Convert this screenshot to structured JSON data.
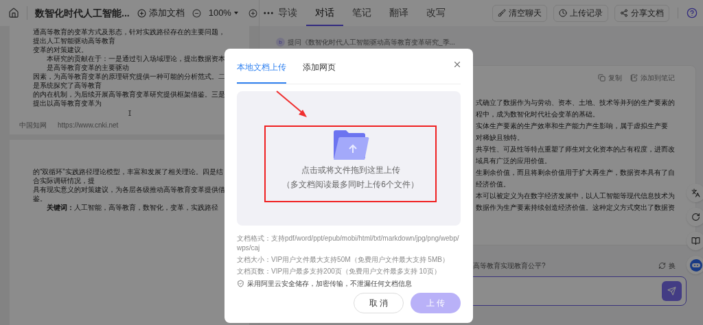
{
  "toolbar": {
    "title": "数智化时代人工智能...",
    "add_document": "添加文档",
    "zoom": "100%"
  },
  "tabs": [
    {
      "label": "导读",
      "selected": false
    },
    {
      "label": "对话",
      "selected": true
    },
    {
      "label": "笔记",
      "selected": false
    },
    {
      "label": "翻译",
      "selected": false
    },
    {
      "label": "改写",
      "selected": false
    }
  ],
  "actions": [
    "清空聊天",
    "上传记录",
    "分享文档"
  ],
  "document": {
    "pages": [
      {
        "lines": [
          {
            "text": "通高等教育的变革方式及形态，针对实践路径存在的主要问题，提出人工智能驱动高等教育",
            "indent": false
          },
          {
            "text": "变革的对策建议。",
            "indent": false
          },
          {
            "text": "本研究的贡献在于：一是通过引入场域理论，提出数据资本是高等教育变革的主要驱动",
            "indent": true
          },
          {
            "text": "因素，为高等教育变革的原理研究提供一种可能的分析范式。二是系统探究了高等教育",
            "indent": false
          },
          {
            "text": "的内在机制，为后续开展高等教育变革研究提供框架借鉴。三是提出以高等教育变革为",
            "indent": false
          }
        ],
        "footer": [
          "中国知网",
          "https://www.cnki.net"
        ]
      },
      {
        "lines": [
          {
            "text": "的“双循环”实践路径理论模型，丰富和发展了相关理论。四是结合实际调研情况，提",
            "indent": false
          },
          {
            "text": "具有现实意义的对策建议，为各层各级推动高等教育变革提供借鉴。",
            "indent": false
          },
          {
            "text": "**关键词：**人工智能，高等教育，数智化，变革，实践路径",
            "indent": true
          }
        ]
      }
    ]
  },
  "chat": {
    "question": "提问《数智化时代人工智能驱动高等教育变革研究_季...",
    "avatar": "b",
    "answer_actions": [
      "复制",
      "添加到笔记"
    ],
    "answer_lines": [
      "式确立了数据作为与劳动、资本、土地、技术等并列的生产要素的",
      "程中，成为数智化时代社会变革的基础。",
      "实体生产要素的生产效率和生产能力产生影响，属于虚拟生产要",
      "对稀缺且独特。",
      "共享性、可及性等特点重塑了师生对文化资本的占有程度，进而改",
      "域具有广泛的应用价值。",
      "生剩余价值，而且将剩余价值用于扩大再生产，数据资本具有了自",
      "经济价值。",
      "本可以被定义为在数字经济发展中，以人工智能等现代信息技术为",
      "数据作为生产要素持续创造经济价值。这种定义方式突出了数据资"
    ],
    "suggestion": "高等教育实现教育公平?",
    "refresh": "换"
  },
  "dialog": {
    "tabs": [
      {
        "label": "本地文档上传",
        "selected": true
      },
      {
        "label": "添加网页",
        "selected": false
      }
    ],
    "drop_text": "点击或将文件拖到这里上传",
    "drop_hint": "（多文档阅读最多同时上传6个文件）",
    "info": [
      "文档格式：支持pdf/word/ppt/epub/mobi/html/txt/markdown/jpg/png/webp/wps/caj",
      "文档大小：VIP用户文件最大支持50M（免费用户文件最大支持 5MB）",
      "文档页数：VIP用户最多支持200页（免费用户文件最多支持 10页）"
    ],
    "security": "采用阿里云安全储存，加密传输，不泄漏任何文档信息",
    "buttons": [
      {
        "label": "取 消",
        "kind": "secondary"
      },
      {
        "label": "上 传",
        "kind": "primary"
      }
    ]
  }
}
